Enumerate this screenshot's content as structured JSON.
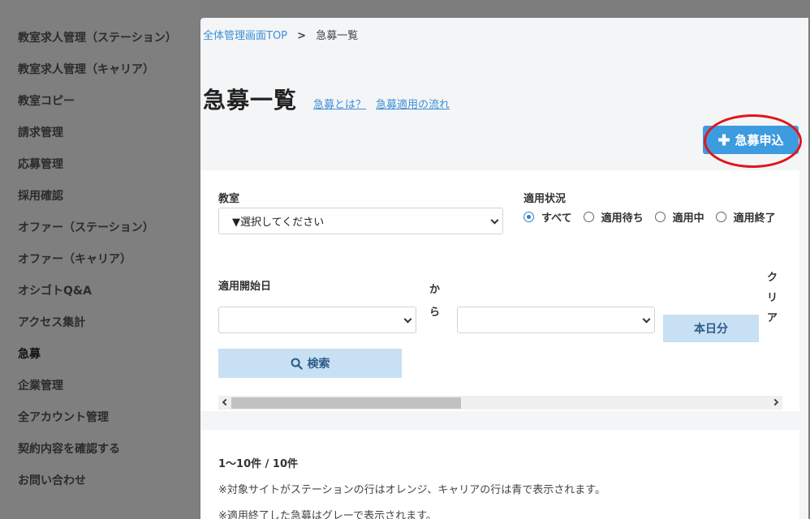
{
  "sidebar": {
    "items": [
      {
        "label": "教室求人管理（ステーション）"
      },
      {
        "label": "教室求人管理（キャリア）"
      },
      {
        "label": "教室コピー"
      },
      {
        "label": "請求管理"
      },
      {
        "label": "応募管理"
      },
      {
        "label": "採用確認"
      },
      {
        "label": "オファー（ステーション）"
      },
      {
        "label": "オファー（キャリア）"
      },
      {
        "label": "オシゴトQ&A"
      },
      {
        "label": "アクセス集計"
      },
      {
        "label": "急募"
      },
      {
        "label": "企業管理"
      },
      {
        "label": "全アカウント管理"
      },
      {
        "label": "契約内容を確認する"
      },
      {
        "label": "お問い合わせ"
      }
    ],
    "active_label": "急募"
  },
  "breadcrumb": {
    "home": "全体管理画面TOP",
    "separator": ">",
    "current": "急募一覧"
  },
  "page": {
    "title": "急募一覧",
    "link_what": "急募とは？",
    "link_flow": "急募適用の流れ",
    "apply_button": "急募申込",
    "apply_icon": "plus-icon"
  },
  "filters": {
    "classroom_label": "教室",
    "classroom_value": "▼選択してください",
    "status_label": "適用状況",
    "status_options": [
      "すべて",
      "適用待ち",
      "適用中",
      "適用終了"
    ],
    "status_selected": "すべて",
    "start_date_label": "適用開始日",
    "from_text": "から",
    "today_button": "本日分",
    "clear_text": "クリア",
    "search_button": "検索",
    "search_icon": "search-icon"
  },
  "results": {
    "count": "1〜10件 / 10件",
    "note1": "※対象サイトがステーションの行はオレンジ、キャリアの行は青で表示されます。",
    "note2": "※適用終了した急募はグレーで表示されます。"
  },
  "colors": {
    "accent": "#3d9be0",
    "link": "#3b8fd6",
    "button_light": "#c7e0f4",
    "highlight": "#e0161c"
  }
}
